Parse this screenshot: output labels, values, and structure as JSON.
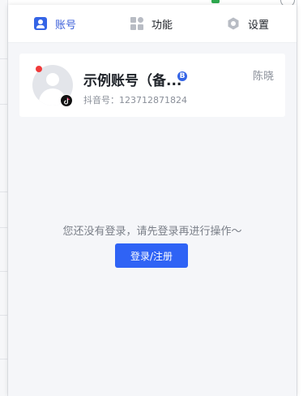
{
  "tabs": [
    {
      "label": "账号",
      "icon": "account-icon",
      "active": true
    },
    {
      "label": "功能",
      "icon": "grid-icon",
      "active": false
    },
    {
      "label": "设置",
      "icon": "gear-icon",
      "active": false
    }
  ],
  "account_card": {
    "name": "示例账号（备...",
    "badge": "B",
    "douyin_id": "抖音号：123712871824",
    "operator": "陈晓"
  },
  "empty_state": {
    "message": "您还没有登录，请先登录再进行操作～",
    "button_label": "登录/注册"
  },
  "colors": {
    "accent": "#2f63f5",
    "active_tab": "#3b5fd9",
    "status_dot": "#f03a3a"
  }
}
